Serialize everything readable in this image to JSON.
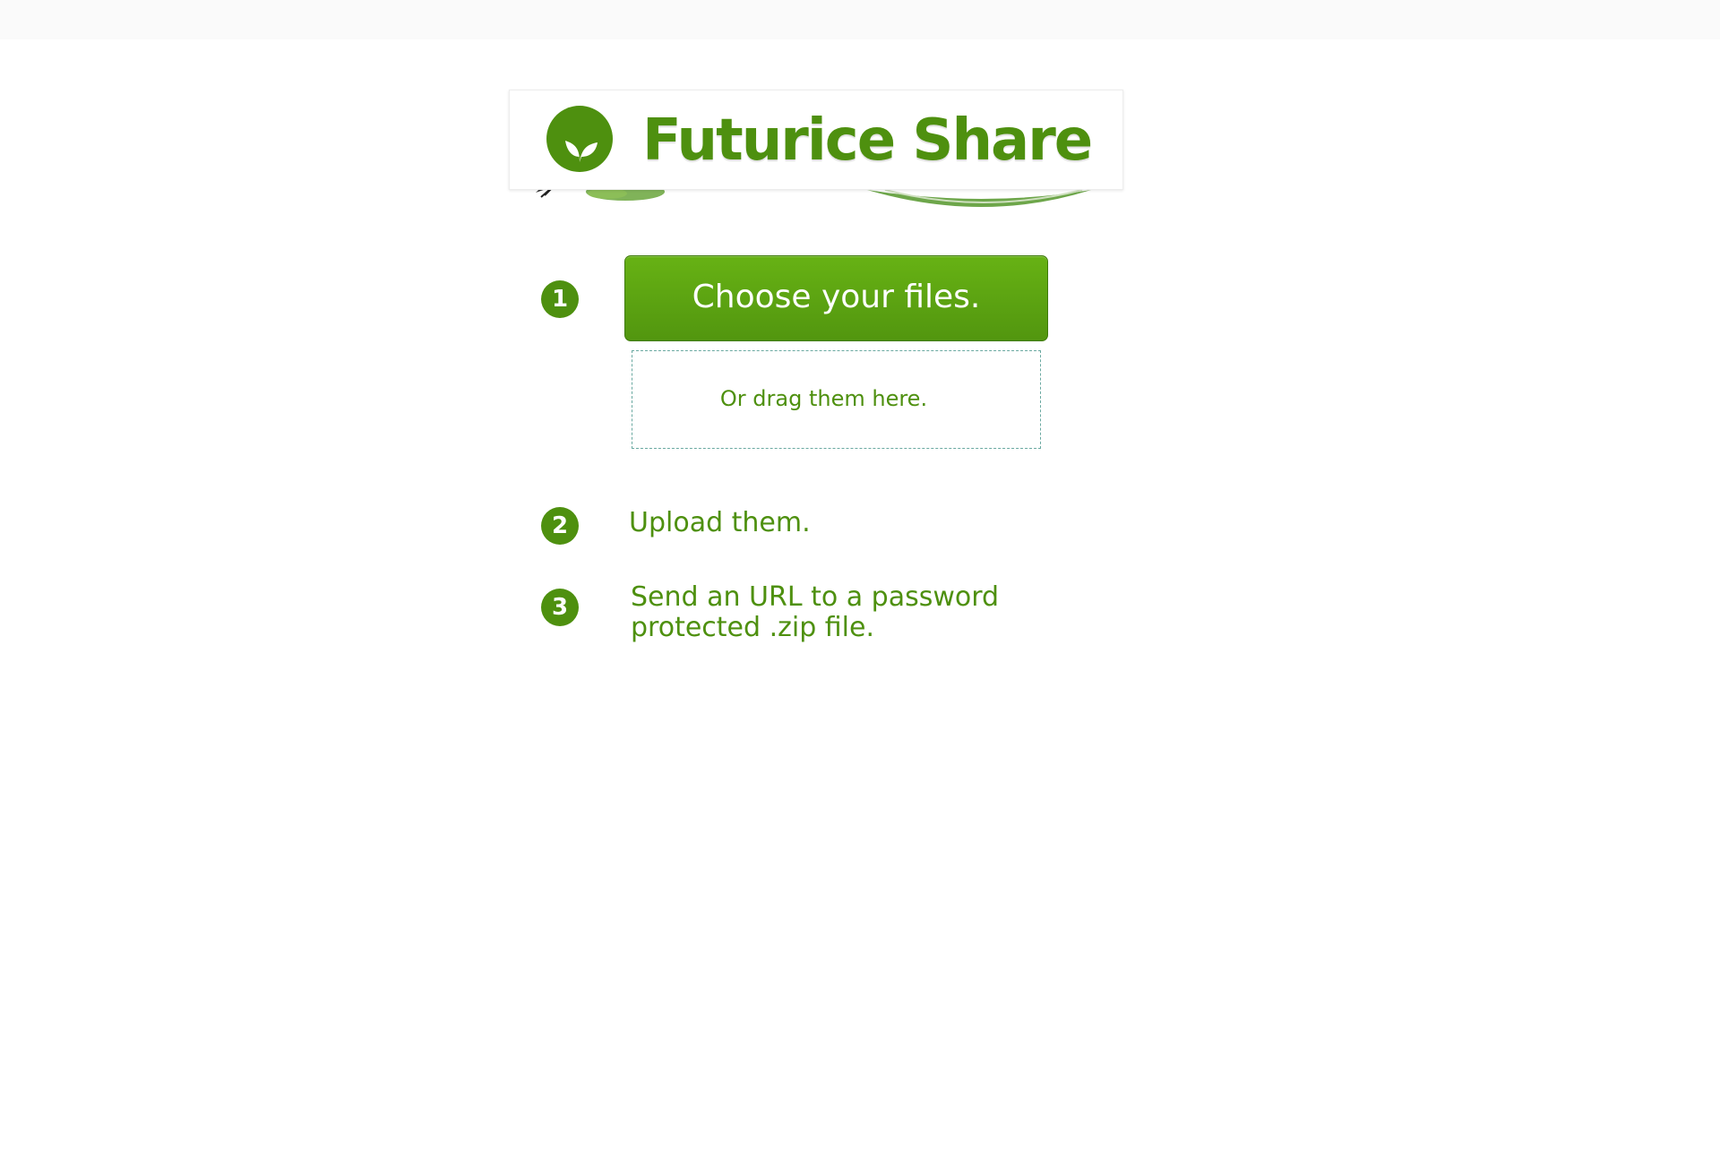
{
  "header": {
    "app_name": "Futurice Share",
    "logo_icon": "leaf-sprout-icon",
    "brand_color": "#4e900f"
  },
  "steps": [
    {
      "number": "1"
    },
    {
      "number": "2",
      "text": "Upload them."
    },
    {
      "number": "3",
      "text": "Send an URL to a password protected .zip file."
    }
  ],
  "upload": {
    "choose_label": "Choose your files.",
    "drop_label": "Or drag them here."
  }
}
